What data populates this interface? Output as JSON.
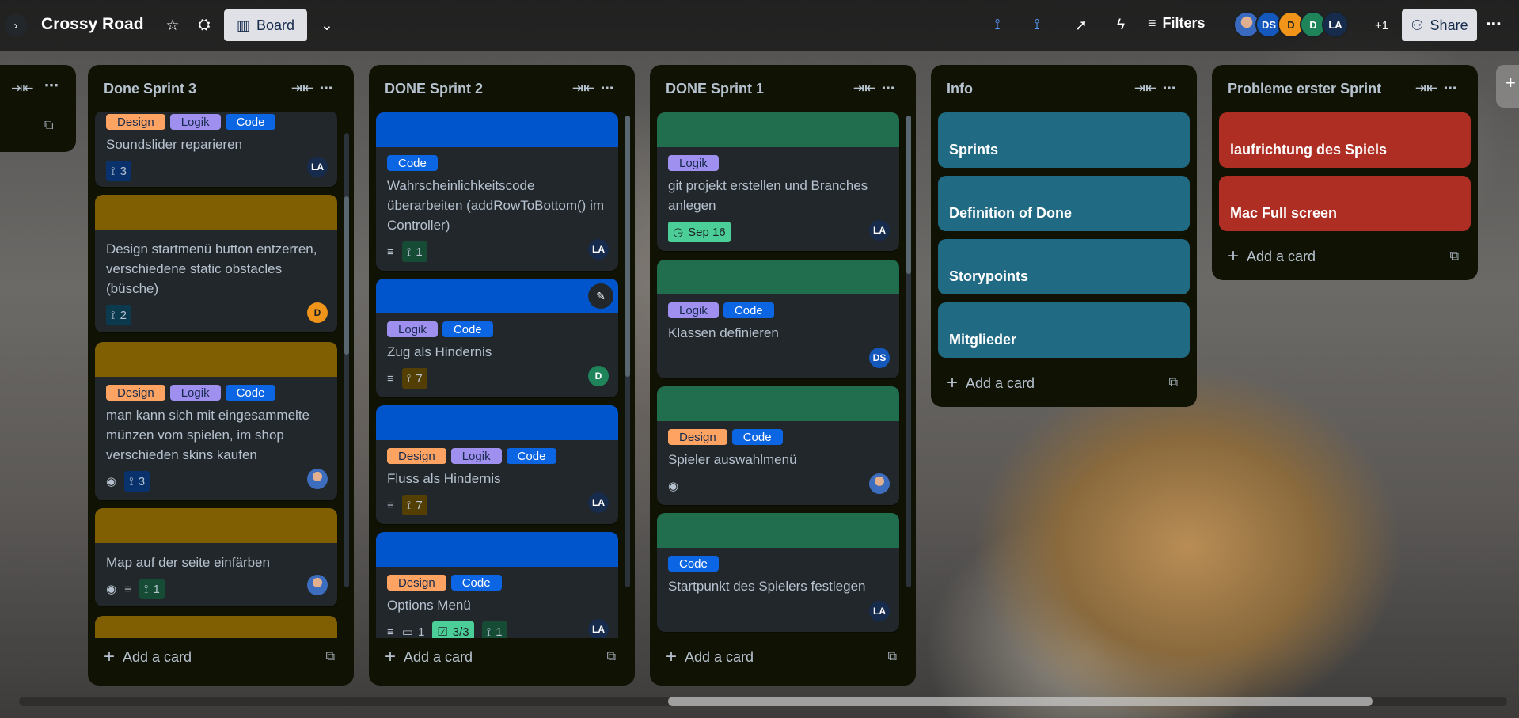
{
  "header": {
    "board_title": "Crossy Road",
    "view_label": "Board",
    "filters_label": "Filters",
    "share_label": "Share",
    "members_more": "+1",
    "members": [
      "DS",
      "D",
      "D",
      "LA"
    ]
  },
  "stub_list": {
    "icons": [
      "collapse-icon",
      "more-icon"
    ]
  },
  "lists": [
    {
      "title": "Done Sprint 3",
      "add_label": "Add a card",
      "cards": [
        {
          "labels": [
            "Design",
            "Logik",
            "Code"
          ],
          "title": "Soundslider reparieren",
          "checklist": "3",
          "member": "LA"
        },
        {
          "title": "Design startmenü button entzerren, verschiedene static obstacles (büsche)",
          "checklist": "2",
          "member": "D"
        },
        {
          "labels": [
            "Design",
            "Logik",
            "Code"
          ],
          "title": "man kann sich mit eingesammelte münzen vom spielen, im shop verschieden skins kaufen",
          "checklist": "3"
        },
        {
          "title": "Map auf der seite einfärben",
          "checklist": "1"
        }
      ]
    },
    {
      "title": "DONE Sprint 2",
      "add_label": "Add a card",
      "cards": [
        {
          "labels": [
            "Code"
          ],
          "title": "Wahrscheinlichkeitscode überarbeiten (addRowToBottom() im Controller)",
          "checklist": "1",
          "member": "LA"
        },
        {
          "labels": [
            "Logik",
            "Code"
          ],
          "title": "Zug als Hindernis",
          "checklist": "7",
          "member": "D"
        },
        {
          "labels": [
            "Design",
            "Logik",
            "Code"
          ],
          "title": "Fluss als Hindernis",
          "checklist": "7",
          "member": "LA"
        },
        {
          "labels": [
            "Design",
            "Code"
          ],
          "title": "Options Menü",
          "comments": "1",
          "checked": "3/3",
          "checklist": "1",
          "member": "LA"
        }
      ]
    },
    {
      "title": "DONE Sprint 1",
      "add_label": "Add a card",
      "cards": [
        {
          "labels": [
            "Logik"
          ],
          "title": "git projekt erstellen und Branches anlegen",
          "date": "Sep 16",
          "member": "LA"
        },
        {
          "labels": [
            "Logik",
            "Code"
          ],
          "title": "Klassen definieren",
          "member": "DS"
        },
        {
          "labels": [
            "Design",
            "Code"
          ],
          "title": "Spieler auswahlmenü"
        },
        {
          "labels": [
            "Code"
          ],
          "title": "Startpunkt des Spielers festlegen",
          "member": "LA"
        }
      ]
    },
    {
      "title": "Info",
      "add_label": "Add a card",
      "cards": [
        {
          "title": "Sprints"
        },
        {
          "title": "Definition of Done"
        },
        {
          "title": "Storypoints"
        },
        {
          "title": "Mitglieder"
        }
      ]
    },
    {
      "title": "Probleme erster Sprint",
      "add_label": "Add a card",
      "cards": [
        {
          "title": "laufrichtung des Spiels"
        },
        {
          "title": "Mac Full screen"
        }
      ]
    }
  ],
  "colors": {
    "list_bg": "#101204",
    "card_bg": "#22272b",
    "cover_blue": "#0055cc",
    "cover_green": "#216e4e",
    "cover_olive": "#7f5f01",
    "info_teal": "#206a83",
    "problem_red": "#ae2e24"
  }
}
